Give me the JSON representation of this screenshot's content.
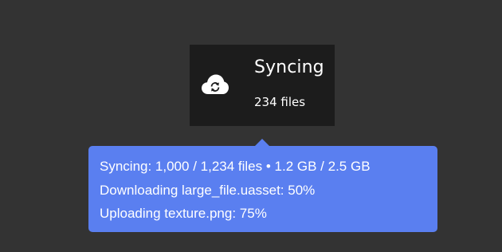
{
  "sync_card": {
    "icon": "cloud-sync-icon",
    "title": "Syncing",
    "subtitle": "234 files"
  },
  "tooltip": {
    "lines": [
      "Syncing: 1,000 / 1,234 files • 1.2 GB / 2.5 GB",
      "Downloading large_file.uasset: 50%",
      "Uploading texture.png: 75%"
    ]
  },
  "colors": {
    "background": "#333333",
    "card": "#1c1c1c",
    "tooltip": "#5a7ff0",
    "text": "#ffffff"
  }
}
